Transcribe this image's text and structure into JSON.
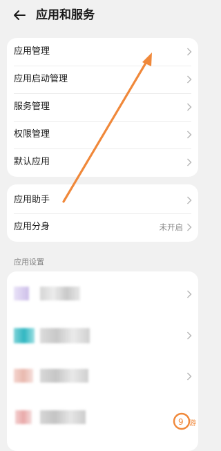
{
  "header": {
    "title": "应用和服务"
  },
  "group1": [
    {
      "label": "应用管理"
    },
    {
      "label": "应用启动管理"
    },
    {
      "label": "服务管理"
    },
    {
      "label": "权限管理"
    },
    {
      "label": "默认应用"
    }
  ],
  "group2": [
    {
      "label": "应用助手",
      "value": ""
    },
    {
      "label": "应用分身",
      "value": "未开启"
    }
  ],
  "section": {
    "label": "应用设置"
  },
  "icons": {
    "back": "arrow-left-icon",
    "chevron": "chevron-right-icon"
  },
  "colors": {
    "background": "#f1f1f1",
    "card": "#ffffff",
    "annotation_arrow": "#f0883a"
  }
}
